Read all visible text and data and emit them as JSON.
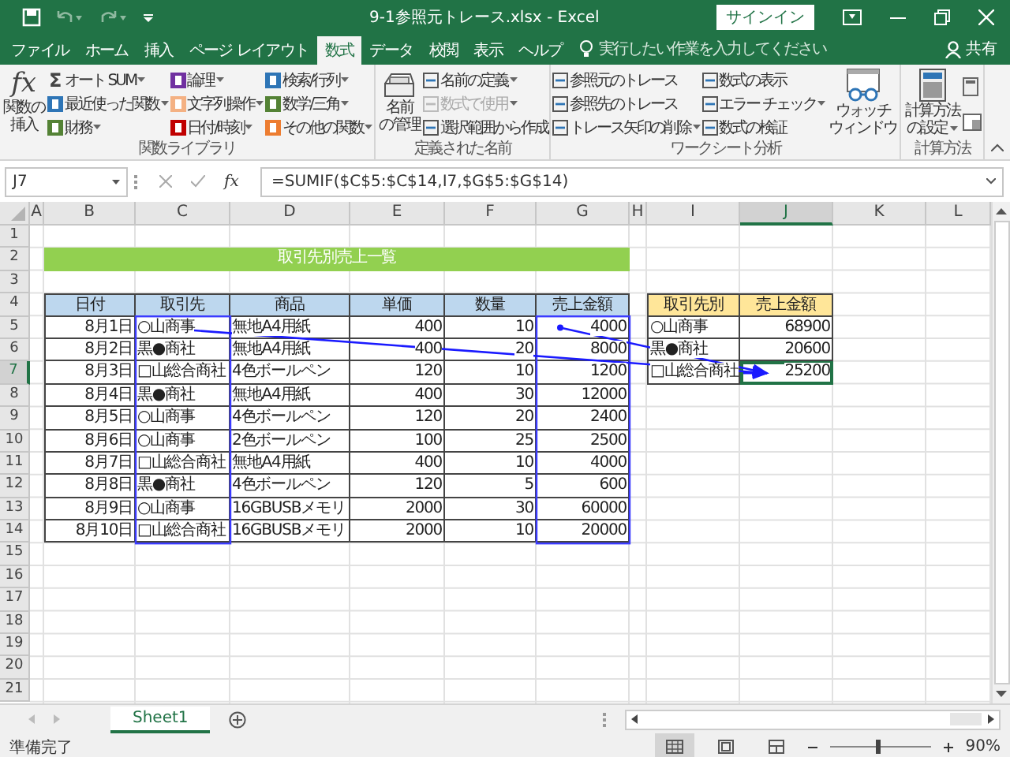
{
  "window": {
    "title": "9-1参照元トレース.xlsx - Excel",
    "sign_in": "サインイン"
  },
  "tabs": [
    {
      "label": "ファイル",
      "selected": false
    },
    {
      "label": "ホーム",
      "selected": false
    },
    {
      "label": "挿入",
      "selected": false
    },
    {
      "label": "ページ レイアウト",
      "selected": false
    },
    {
      "label": "数式",
      "selected": true
    },
    {
      "label": "データ",
      "selected": false
    },
    {
      "label": "校閲",
      "selected": false
    },
    {
      "label": "表示",
      "selected": false
    },
    {
      "label": "ヘルプ",
      "selected": false
    }
  ],
  "tell_me": "実行したい作業を入力してください",
  "share": "共有",
  "ribbon": {
    "groups": [
      {
        "label": "関数ライブラリ",
        "columns": [
          {
            "kind": "large",
            "items": [
              {
                "lines": [
                  "関数の",
                  "挿入"
                ],
                "glyph": "fx",
                "dropdown": false
              }
            ]
          },
          {
            "kind": "small",
            "items": [
              {
                "label": "オート SUM",
                "glyph": "Σ",
                "dropdown": true
              },
              {
                "label": "最近使った関数",
                "color": "#2e75b6",
                "dropdown": true
              },
              {
                "label": "財務",
                "color": "#548235",
                "dropdown": true
              }
            ]
          },
          {
            "kind": "small",
            "items": [
              {
                "label": "論理",
                "color": "#7030a0",
                "dropdown": true
              },
              {
                "label": "文字列操作",
                "color": "#f4b183",
                "dropdown": true
              },
              {
                "label": "日付/時刻",
                "color": "#c00000",
                "dropdown": true
              }
            ]
          },
          {
            "kind": "small",
            "items": [
              {
                "label": "検索/行列",
                "color": "#2e75b6",
                "dropdown": true
              },
              {
                "label": "数学/三角",
                "color": "#548235",
                "dropdown": true
              },
              {
                "label": "その他の関数",
                "color": "#ed7d31",
                "dropdown": true
              }
            ]
          }
        ]
      },
      {
        "label": "定義された名前",
        "columns": [
          {
            "kind": "large",
            "items": [
              {
                "lines": [
                  "名前",
                  "の管理"
                ],
                "dropdown": false
              }
            ]
          },
          {
            "kind": "small",
            "items": [
              {
                "label": "名前の定義",
                "dropdown": true,
                "disabled": false
              },
              {
                "label": "数式で使用",
                "dropdown": true,
                "disabled": true
              },
              {
                "label": "選択範囲から作成",
                "dropdown": false,
                "disabled": false
              }
            ]
          }
        ]
      },
      {
        "label": "ワークシート分析",
        "columns": [
          {
            "kind": "small",
            "items": [
              {
                "label": "参照元のトレース",
                "dropdown": false
              },
              {
                "label": "参照先のトレース",
                "dropdown": false
              },
              {
                "label": "トレース矢印の削除",
                "dropdown": true
              }
            ]
          },
          {
            "kind": "small",
            "items": [
              {
                "label": "数式の表示",
                "dropdown": false
              },
              {
                "label": "エラー チェック",
                "dropdown": true
              },
              {
                "label": "数式の検証",
                "dropdown": false
              }
            ]
          },
          {
            "kind": "large",
            "items": [
              {
                "lines": [
                  "ウォッチ",
                  "ウィンドウ"
                ],
                "dropdown": false
              }
            ]
          }
        ]
      },
      {
        "label": "計算方法",
        "columns": [
          {
            "kind": "large",
            "items": [
              {
                "lines": [
                  "計算方法",
                  "の設定"
                ],
                "dropdown": true
              }
            ]
          }
        ]
      }
    ]
  },
  "formula_bar": {
    "name_box": "J7",
    "fx": "fx",
    "formula": "=SUMIF($C$5:$C$14,I7,$G$5:$G$14)"
  },
  "sheet": {
    "columns": [
      {
        "label": "A",
        "selected": false
      },
      {
        "label": "B",
        "selected": false
      },
      {
        "label": "C",
        "selected": false
      },
      {
        "label": "D",
        "selected": false
      },
      {
        "label": "E",
        "selected": false
      },
      {
        "label": "F",
        "selected": false
      },
      {
        "label": "G",
        "selected": false
      },
      {
        "label": "H",
        "selected": false
      },
      {
        "label": "I",
        "selected": false
      },
      {
        "label": "J",
        "selected": true
      },
      {
        "label": "K",
        "selected": false
      },
      {
        "label": "L",
        "selected": false
      }
    ],
    "rows": [
      {
        "label": "1",
        "selected": false
      },
      {
        "label": "2",
        "selected": false
      },
      {
        "label": "3",
        "selected": false
      },
      {
        "label": "4",
        "selected": false
      },
      {
        "label": "5",
        "selected": false
      },
      {
        "label": "6",
        "selected": false
      },
      {
        "label": "7",
        "selected": true
      },
      {
        "label": "8",
        "selected": false
      },
      {
        "label": "9",
        "selected": false
      },
      {
        "label": "10",
        "selected": false
      },
      {
        "label": "11",
        "selected": false
      },
      {
        "label": "12",
        "selected": false
      },
      {
        "label": "13",
        "selected": false
      },
      {
        "label": "14",
        "selected": false
      },
      {
        "label": "15",
        "selected": false
      },
      {
        "label": "16",
        "selected": false
      },
      {
        "label": "17",
        "selected": false
      },
      {
        "label": "18",
        "selected": false
      },
      {
        "label": "19",
        "selected": false
      },
      {
        "label": "20",
        "selected": false
      },
      {
        "label": "21",
        "selected": false
      }
    ],
    "title": "取引先別売上一覧",
    "table": {
      "columns": [
        "日付",
        "取引先",
        "商品",
        "単価",
        "数量",
        "売上金額"
      ],
      "rows": [
        [
          "8月1日",
          "○山商事",
          "無地A4用紙",
          "400",
          "10",
          "4000"
        ],
        [
          "8月2日",
          "黒●商社",
          "無地A4用紙",
          "400",
          "20",
          "8000"
        ],
        [
          "8月3日",
          "□山総合商社",
          "4色ボールペン",
          "120",
          "10",
          "1200"
        ],
        [
          "8月4日",
          "黒●商社",
          "無地A4用紙",
          "400",
          "30",
          "12000"
        ],
        [
          "8月5日",
          "○山商事",
          "4色ボールペン",
          "120",
          "20",
          "2400"
        ],
        [
          "8月6日",
          "○山商事",
          "2色ボールペン",
          "100",
          "25",
          "2500"
        ],
        [
          "8月7日",
          "□山総合商社",
          "無地A4用紙",
          "400",
          "10",
          "4000"
        ],
        [
          "8月8日",
          "黒●商社",
          "4色ボールペン",
          "120",
          "5",
          "600"
        ],
        [
          "8月9日",
          "○山商事",
          "16GBUSBメモリ",
          "2000",
          "30",
          "60000"
        ],
        [
          "8月10日",
          "□山総合商社",
          "16GBUSBメモリ",
          "2000",
          "10",
          "20000"
        ]
      ]
    },
    "summary": {
      "columns": [
        "取引先別",
        "売上金額"
      ],
      "rows": [
        [
          "○山商事",
          "68900"
        ],
        [
          "黒●商社",
          "20600"
        ],
        [
          "□山総合商社",
          "25200"
        ]
      ]
    }
  },
  "sheet_tabs": [
    {
      "label": "Sheet1",
      "selected": true
    }
  ],
  "status_bar": {
    "status": "準備完了",
    "zoom": "90%",
    "zoom_slider": {
      "level": 0.47
    }
  }
}
